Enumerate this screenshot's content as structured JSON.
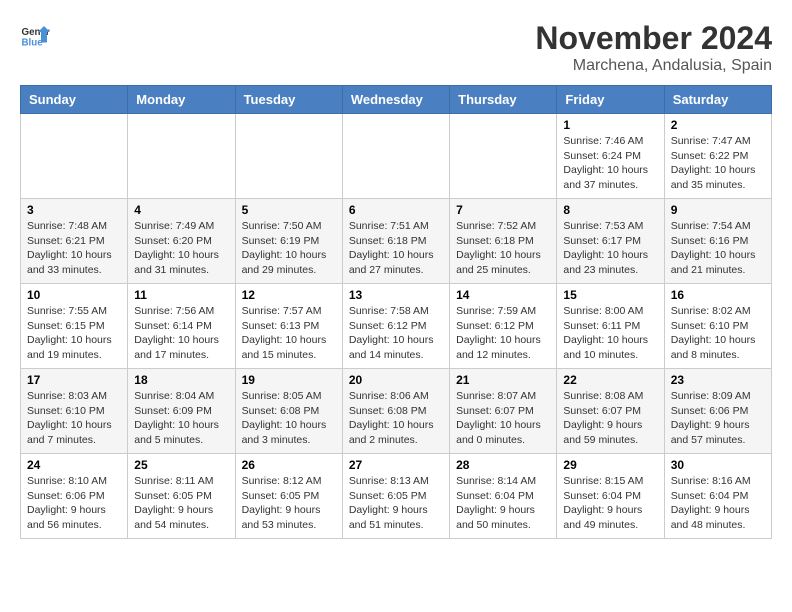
{
  "header": {
    "logo_line1": "General",
    "logo_line2": "Blue",
    "month_year": "November 2024",
    "location": "Marchena, Andalusia, Spain"
  },
  "weekdays": [
    "Sunday",
    "Monday",
    "Tuesday",
    "Wednesday",
    "Thursday",
    "Friday",
    "Saturday"
  ],
  "weeks": [
    [
      {
        "day": "",
        "info": ""
      },
      {
        "day": "",
        "info": ""
      },
      {
        "day": "",
        "info": ""
      },
      {
        "day": "",
        "info": ""
      },
      {
        "day": "",
        "info": ""
      },
      {
        "day": "1",
        "info": "Sunrise: 7:46 AM\nSunset: 6:24 PM\nDaylight: 10 hours and 37 minutes."
      },
      {
        "day": "2",
        "info": "Sunrise: 7:47 AM\nSunset: 6:22 PM\nDaylight: 10 hours and 35 minutes."
      }
    ],
    [
      {
        "day": "3",
        "info": "Sunrise: 7:48 AM\nSunset: 6:21 PM\nDaylight: 10 hours and 33 minutes."
      },
      {
        "day": "4",
        "info": "Sunrise: 7:49 AM\nSunset: 6:20 PM\nDaylight: 10 hours and 31 minutes."
      },
      {
        "day": "5",
        "info": "Sunrise: 7:50 AM\nSunset: 6:19 PM\nDaylight: 10 hours and 29 minutes."
      },
      {
        "day": "6",
        "info": "Sunrise: 7:51 AM\nSunset: 6:18 PM\nDaylight: 10 hours and 27 minutes."
      },
      {
        "day": "7",
        "info": "Sunrise: 7:52 AM\nSunset: 6:18 PM\nDaylight: 10 hours and 25 minutes."
      },
      {
        "day": "8",
        "info": "Sunrise: 7:53 AM\nSunset: 6:17 PM\nDaylight: 10 hours and 23 minutes."
      },
      {
        "day": "9",
        "info": "Sunrise: 7:54 AM\nSunset: 6:16 PM\nDaylight: 10 hours and 21 minutes."
      }
    ],
    [
      {
        "day": "10",
        "info": "Sunrise: 7:55 AM\nSunset: 6:15 PM\nDaylight: 10 hours and 19 minutes."
      },
      {
        "day": "11",
        "info": "Sunrise: 7:56 AM\nSunset: 6:14 PM\nDaylight: 10 hours and 17 minutes."
      },
      {
        "day": "12",
        "info": "Sunrise: 7:57 AM\nSunset: 6:13 PM\nDaylight: 10 hours and 15 minutes."
      },
      {
        "day": "13",
        "info": "Sunrise: 7:58 AM\nSunset: 6:12 PM\nDaylight: 10 hours and 14 minutes."
      },
      {
        "day": "14",
        "info": "Sunrise: 7:59 AM\nSunset: 6:12 PM\nDaylight: 10 hours and 12 minutes."
      },
      {
        "day": "15",
        "info": "Sunrise: 8:00 AM\nSunset: 6:11 PM\nDaylight: 10 hours and 10 minutes."
      },
      {
        "day": "16",
        "info": "Sunrise: 8:02 AM\nSunset: 6:10 PM\nDaylight: 10 hours and 8 minutes."
      }
    ],
    [
      {
        "day": "17",
        "info": "Sunrise: 8:03 AM\nSunset: 6:10 PM\nDaylight: 10 hours and 7 minutes."
      },
      {
        "day": "18",
        "info": "Sunrise: 8:04 AM\nSunset: 6:09 PM\nDaylight: 10 hours and 5 minutes."
      },
      {
        "day": "19",
        "info": "Sunrise: 8:05 AM\nSunset: 6:08 PM\nDaylight: 10 hours and 3 minutes."
      },
      {
        "day": "20",
        "info": "Sunrise: 8:06 AM\nSunset: 6:08 PM\nDaylight: 10 hours and 2 minutes."
      },
      {
        "day": "21",
        "info": "Sunrise: 8:07 AM\nSunset: 6:07 PM\nDaylight: 10 hours and 0 minutes."
      },
      {
        "day": "22",
        "info": "Sunrise: 8:08 AM\nSunset: 6:07 PM\nDaylight: 9 hours and 59 minutes."
      },
      {
        "day": "23",
        "info": "Sunrise: 8:09 AM\nSunset: 6:06 PM\nDaylight: 9 hours and 57 minutes."
      }
    ],
    [
      {
        "day": "24",
        "info": "Sunrise: 8:10 AM\nSunset: 6:06 PM\nDaylight: 9 hours and 56 minutes."
      },
      {
        "day": "25",
        "info": "Sunrise: 8:11 AM\nSunset: 6:05 PM\nDaylight: 9 hours and 54 minutes."
      },
      {
        "day": "26",
        "info": "Sunrise: 8:12 AM\nSunset: 6:05 PM\nDaylight: 9 hours and 53 minutes."
      },
      {
        "day": "27",
        "info": "Sunrise: 8:13 AM\nSunset: 6:05 PM\nDaylight: 9 hours and 51 minutes."
      },
      {
        "day": "28",
        "info": "Sunrise: 8:14 AM\nSunset: 6:04 PM\nDaylight: 9 hours and 50 minutes."
      },
      {
        "day": "29",
        "info": "Sunrise: 8:15 AM\nSunset: 6:04 PM\nDaylight: 9 hours and 49 minutes."
      },
      {
        "day": "30",
        "info": "Sunrise: 8:16 AM\nSunset: 6:04 PM\nDaylight: 9 hours and 48 minutes."
      }
    ]
  ]
}
